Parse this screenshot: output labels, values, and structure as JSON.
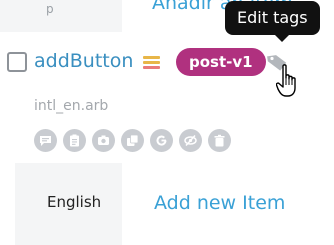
{
  "tooltip": {
    "text": "Edit tags"
  },
  "top_row": {
    "partial_text": "Añadir an Item",
    "small_text": "p"
  },
  "key": {
    "name": "addButton",
    "tag": "post-v1",
    "file": "intl_en.arb"
  },
  "icons": {
    "status": "lines-icon",
    "edit_tags": "tag-icon",
    "actions": [
      "comment-icon",
      "clipboard-icon",
      "screenshot-icon",
      "copy-icon",
      "google-translate-icon",
      "hide-icon",
      "delete-icon"
    ]
  },
  "translation": {
    "language": "English",
    "add_item_label": "Add new Item"
  },
  "colors": {
    "tag_pill": "#b0317f",
    "link": "#3aa1d6",
    "tooltip_bg": "#111111",
    "icon_circle": "#c9ccd1"
  }
}
